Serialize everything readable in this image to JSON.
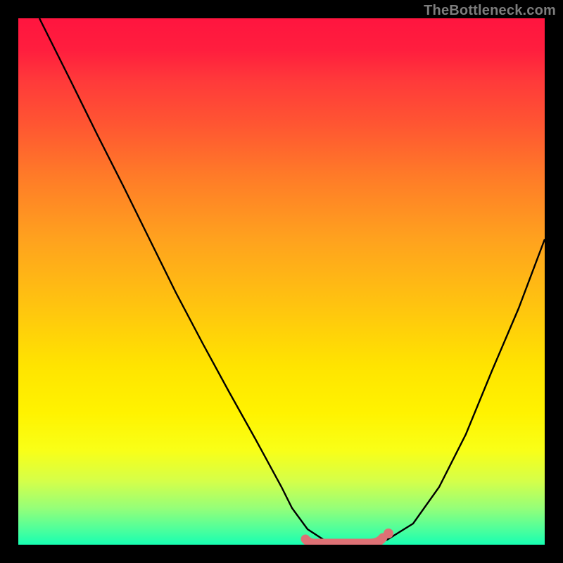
{
  "watermark": "TheBottleneck.com",
  "chart_data": {
    "type": "line",
    "title": "",
    "xlabel": "",
    "ylabel": "",
    "xlim": [
      0,
      100
    ],
    "ylim": [
      0,
      100
    ],
    "grid": false,
    "series": [
      {
        "name": "curve",
        "x": [
          4,
          10,
          15,
          20,
          25,
          30,
          35,
          40,
          45,
          50,
          52,
          55,
          58,
          60,
          63,
          66,
          70,
          75,
          80,
          85,
          90,
          95,
          100
        ],
        "y": [
          100,
          88,
          78,
          68,
          58,
          48,
          38,
          29,
          20,
          11,
          7,
          3,
          1,
          0,
          0,
          0,
          1,
          4,
          11,
          21,
          33,
          45,
          58
        ]
      }
    ],
    "flat_band": {
      "x_start": 55,
      "x_end": 70,
      "y": 0.5,
      "color": "#de7175"
    },
    "background_gradient": {
      "top": "#ff153f",
      "middle": "#ffe400",
      "bottom": "#17ffb2"
    }
  }
}
